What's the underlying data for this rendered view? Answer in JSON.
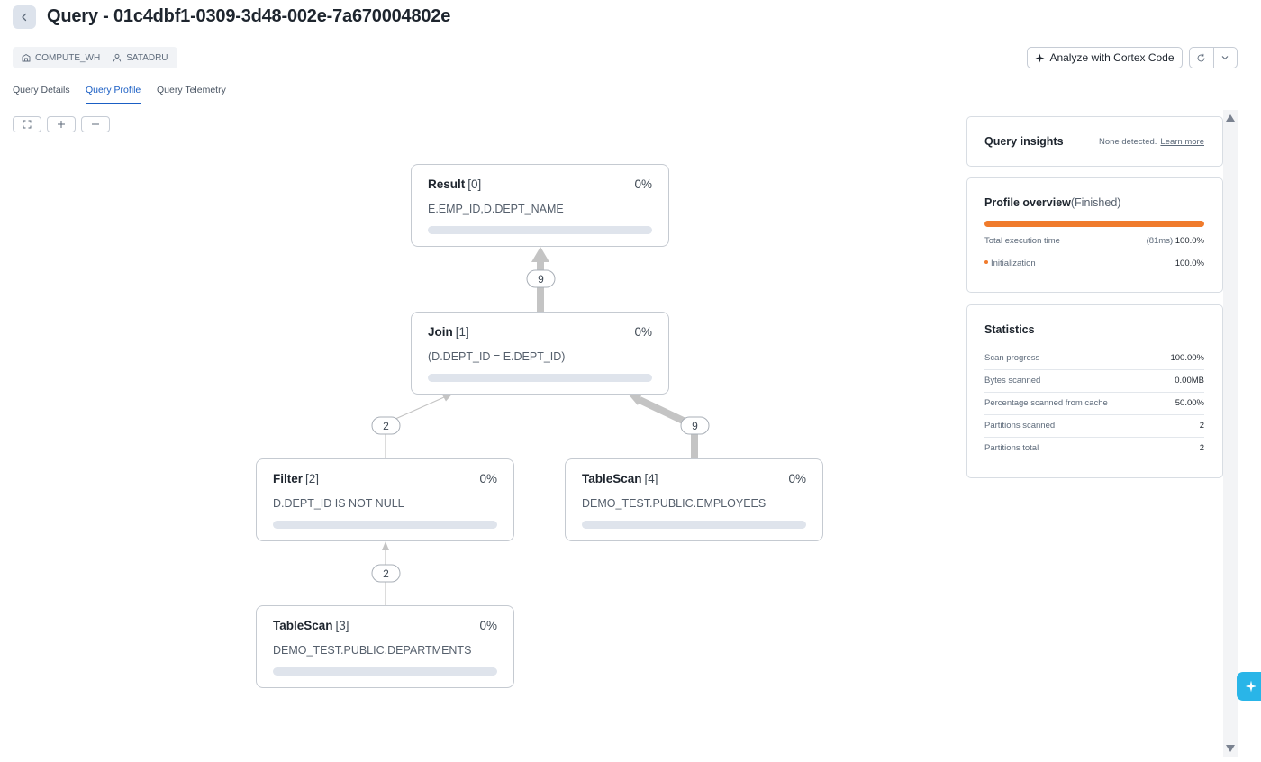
{
  "header": {
    "title": "Query - 01c4dbf1-0309-3d48-002e-7a670004802e"
  },
  "meta": {
    "warehouse": "COMPUTE_WH",
    "user": "SATADRU"
  },
  "actions": {
    "analyze_label": "Analyze with Cortex Code"
  },
  "tabs": [
    {
      "label": "Query Details"
    },
    {
      "label": "Query Profile"
    },
    {
      "label": "Query Telemetry"
    }
  ],
  "active_tab": "Query Profile",
  "graph": {
    "nodes": [
      {
        "name": "Result",
        "id": "[0]",
        "pct": "0%",
        "detail": "E.EMP_ID,D.DEPT_NAME"
      },
      {
        "name": "Join",
        "id": "[1]",
        "pct": "0%",
        "detail": "(D.DEPT_ID = E.DEPT_ID)"
      },
      {
        "name": "Filter",
        "id": "[2]",
        "pct": "0%",
        "detail": "D.DEPT_ID IS NOT NULL"
      },
      {
        "name": "TableScan",
        "id": "[4]",
        "pct": "0%",
        "detail": "DEMO_TEST.PUBLIC.EMPLOYEES"
      },
      {
        "name": "TableScan",
        "id": "[3]",
        "pct": "0%",
        "detail": "DEMO_TEST.PUBLIC.DEPARTMENTS"
      }
    ],
    "edges": [
      {
        "rows": "9"
      },
      {
        "rows": "2"
      },
      {
        "rows": "9"
      },
      {
        "rows": "2"
      }
    ]
  },
  "insights": {
    "title": "Query insights",
    "status": "None detected.",
    "link": "Learn more"
  },
  "overview": {
    "title": "Profile overview",
    "state": "(Finished)",
    "progress_fraction": 1.0,
    "total_label": "Total execution time",
    "total_time": "(81ms)",
    "total_pct": "100.0%",
    "init_label": "Initialization",
    "init_pct": "100.0%"
  },
  "statistics": {
    "title": "Statistics",
    "rows": [
      {
        "label": "Scan progress",
        "value": "100.00%"
      },
      {
        "label": "Bytes scanned",
        "value": "0.00MB"
      },
      {
        "label": "Percentage scanned from cache",
        "value": "50.00%"
      },
      {
        "label": "Partitions scanned",
        "value": "2"
      },
      {
        "label": "Partitions total",
        "value": "2"
      }
    ]
  },
  "colors": {
    "accent": "#1a5ec4",
    "overview_bar": "#f07b2c",
    "assistant": "#29b5e8"
  }
}
